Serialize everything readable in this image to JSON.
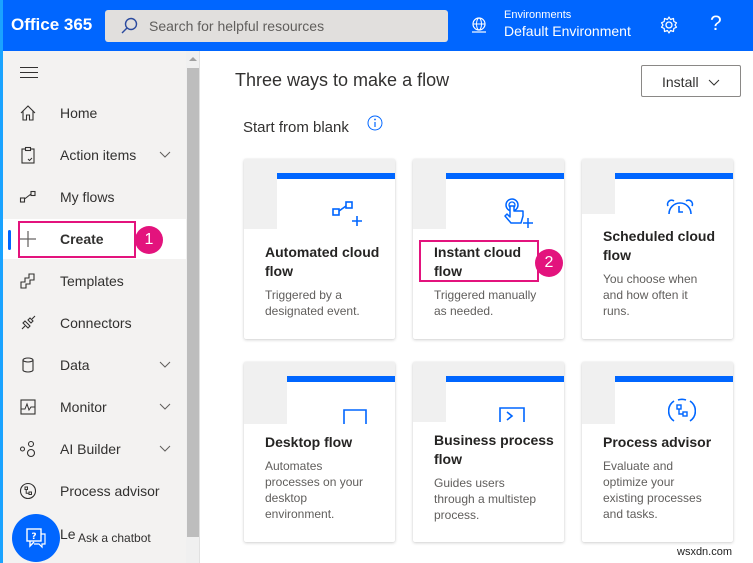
{
  "header": {
    "brand": "Office 365",
    "search_placeholder": "Search for helpful resources",
    "environment_label": "Environments",
    "environment_value": "Default Environment",
    "help_glyph": "?",
    "icons": {
      "search": "search-icon",
      "environment": "globe-icon",
      "settings": "gear-icon",
      "help": "help-icon"
    }
  },
  "sidebar": {
    "items": [
      {
        "label": "Home",
        "icon": "home-icon",
        "expandable": false
      },
      {
        "label": "Action items",
        "icon": "clipboard-icon",
        "expandable": true
      },
      {
        "label": "My flows",
        "icon": "flow-icon",
        "expandable": false
      },
      {
        "label": "Create",
        "icon": "plus-icon",
        "expandable": false,
        "active": true
      },
      {
        "label": "Templates",
        "icon": "templates-icon",
        "expandable": false
      },
      {
        "label": "Connectors",
        "icon": "connector-icon",
        "expandable": false
      },
      {
        "label": "Data",
        "icon": "database-icon",
        "expandable": true
      },
      {
        "label": "Monitor",
        "icon": "monitor-icon",
        "expandable": true
      },
      {
        "label": "AI Builder",
        "icon": "ai-builder-icon",
        "expandable": true
      },
      {
        "label": "Process advisor",
        "icon": "process-advisor-icon",
        "expandable": false
      }
    ],
    "learn_partial": "Le",
    "chatbot_label": "Ask a chatbot"
  },
  "main": {
    "title": "Three ways to make a flow",
    "install_label": "Install",
    "section_title": "Start from blank",
    "cards": [
      {
        "title": "Automated cloud flow",
        "title_lines": [
          "Automated cloud",
          "flow"
        ],
        "description_lines": [
          "Triggered by a",
          "designated event."
        ],
        "icon": "automated-flow-icon"
      },
      {
        "title": "Instant cloud flow",
        "title_lines": [
          "Instant cloud",
          "flow"
        ],
        "description_lines": [
          "Triggered manually",
          "as needed."
        ],
        "icon": "touch-icon"
      },
      {
        "title": "Scheduled cloud flow",
        "title_lines": [
          "Scheduled cloud",
          "flow"
        ],
        "description_lines": [
          "You choose when",
          "and how often it",
          "runs."
        ],
        "icon": "alarm-clock-icon"
      },
      {
        "title": "Desktop flow",
        "title_lines": [
          "Desktop flow"
        ],
        "description_lines": [
          "Automates",
          "processes on your",
          "desktop",
          "environment."
        ],
        "icon": "desktop-icon"
      },
      {
        "title": "Business process flow",
        "title_lines": [
          "Business process",
          "flow"
        ],
        "description_lines": [
          "Guides users",
          "through a multistep",
          "process."
        ],
        "icon": "business-process-icon"
      },
      {
        "title": "Process advisor",
        "title_lines": [
          "Process advisor"
        ],
        "description_lines": [
          "Evaluate and",
          "optimize your",
          "existing processes",
          "and tasks."
        ],
        "icon": "process-advisor-icon"
      }
    ]
  },
  "annotations": {
    "step1": "1",
    "step2": "2",
    "color": "#e3137d"
  },
  "colors": {
    "accent": "#0066ff",
    "sidebar_bg": "#f3f2f1",
    "annotation": "#e3137d"
  },
  "watermark": "wsxdn.com"
}
